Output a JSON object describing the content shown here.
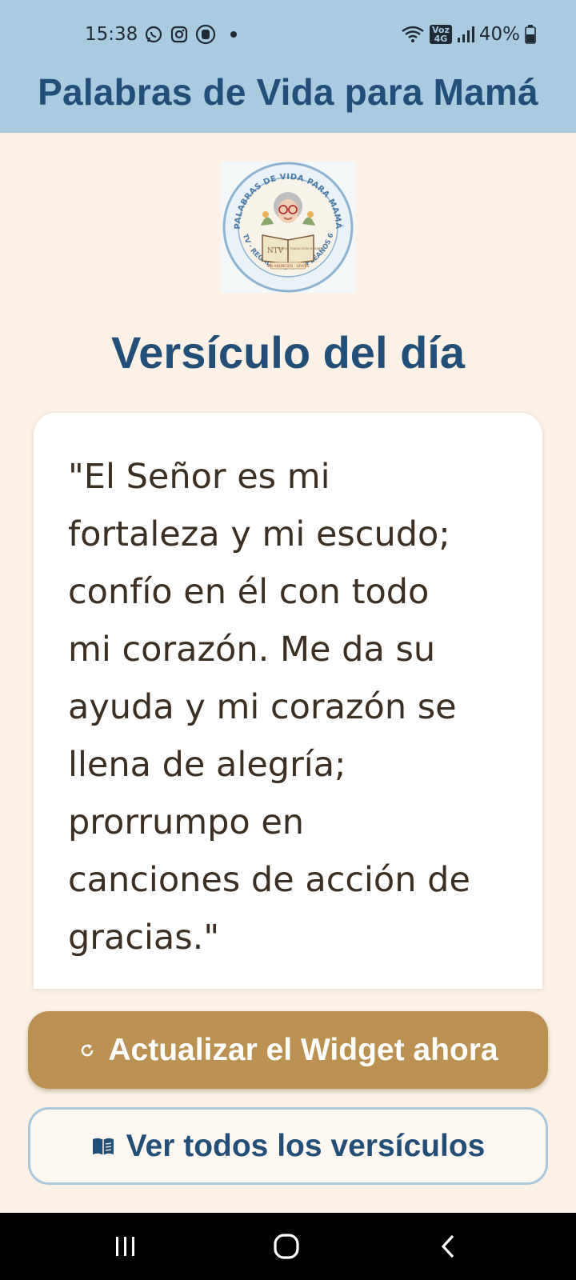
{
  "status_bar": {
    "time": "15:38",
    "left_icons": [
      "whatsapp-icon",
      "instagram-icon",
      "shield-app-icon"
    ],
    "network_badge_top": "Voz",
    "network_badge_bottom": "4G",
    "battery": "40%"
  },
  "header": {
    "title": "Palabras de Vida para Mamá"
  },
  "logo": {
    "ring_text_top": "PALABRAS DE VIDA PARA MAMÁ",
    "ring_text_bottom": "NTV · REGALO DE CUMPLEAÑOS 69",
    "book_left": "NTV",
    "book_right": "NUEVA TRADUCCIÓN VIVIENTE",
    "banner": "SIN ANUNCIOS · GRATIS"
  },
  "section": {
    "title": "Versículo del día"
  },
  "verse": {
    "lines": [
      "\"El Señor es mi",
      "fortaleza y mi escudo;",
      "confío en él con todo",
      "mi corazón. Me da su",
      "ayuda y mi corazón se",
      "llena de alegría;",
      "prorrumpo en",
      "canciones de acción de",
      "gracias.\""
    ]
  },
  "buttons": {
    "refresh_label": "Actualizar el Widget ahora",
    "refresh_icon": "refresh-icon",
    "all_verses_label": "Ver todos los versículos",
    "all_verses_icon": "book-icon"
  },
  "nav": {
    "items": [
      "recent-apps-icon",
      "home-icon",
      "back-icon"
    ]
  },
  "colors": {
    "header_bg": "#a8cbe0",
    "title_blue": "#234e78",
    "page_bg": "#fbf1e6",
    "primary_button": "#bb9053",
    "secondary_border": "#a9c8dc",
    "verse_text": "#3b2e22"
  }
}
